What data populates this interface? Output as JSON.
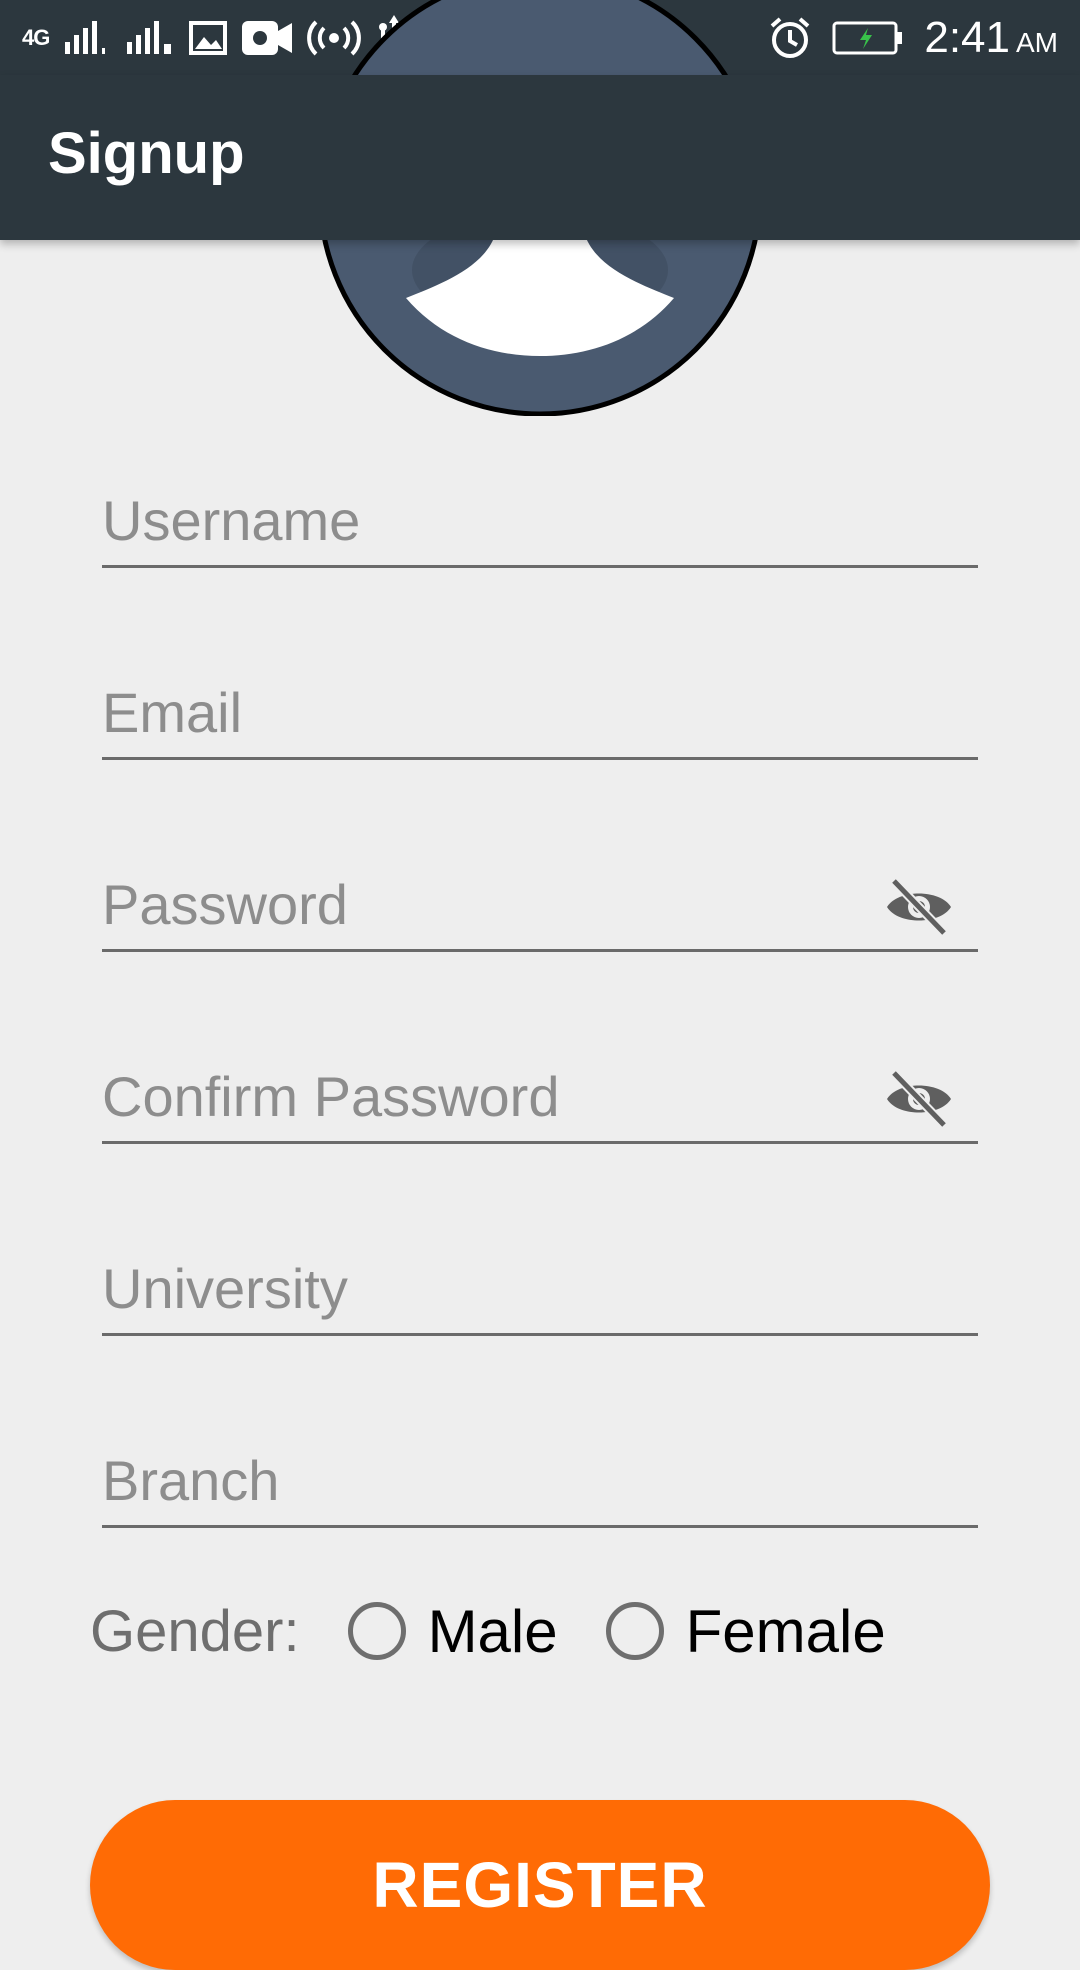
{
  "status_bar": {
    "network": "4G",
    "time": "2:41",
    "ampm": "AM",
    "icons": [
      "signal-1-icon",
      "signal-2-icon",
      "gallery-icon",
      "video-record-icon",
      "hotspot-icon",
      "usb-icon",
      "alarm-icon",
      "battery-charging-icon"
    ]
  },
  "app_bar": {
    "title": "Signup"
  },
  "form": {
    "username_placeholder": "Username",
    "email_placeholder": "Email",
    "password_placeholder": "Password",
    "confirm_password_placeholder": "Confirm Password",
    "university_placeholder": "University",
    "branch_placeholder": "Branch"
  },
  "gender": {
    "label": "Gender:",
    "options": [
      "Male",
      "Female"
    ],
    "selected": null
  },
  "register_button": {
    "label": "REGISTER"
  },
  "colors": {
    "app_bar": "#2c373e",
    "background": "#eeeeee",
    "accent": "#ff6b05",
    "avatar_bg": "#4a5a70"
  }
}
